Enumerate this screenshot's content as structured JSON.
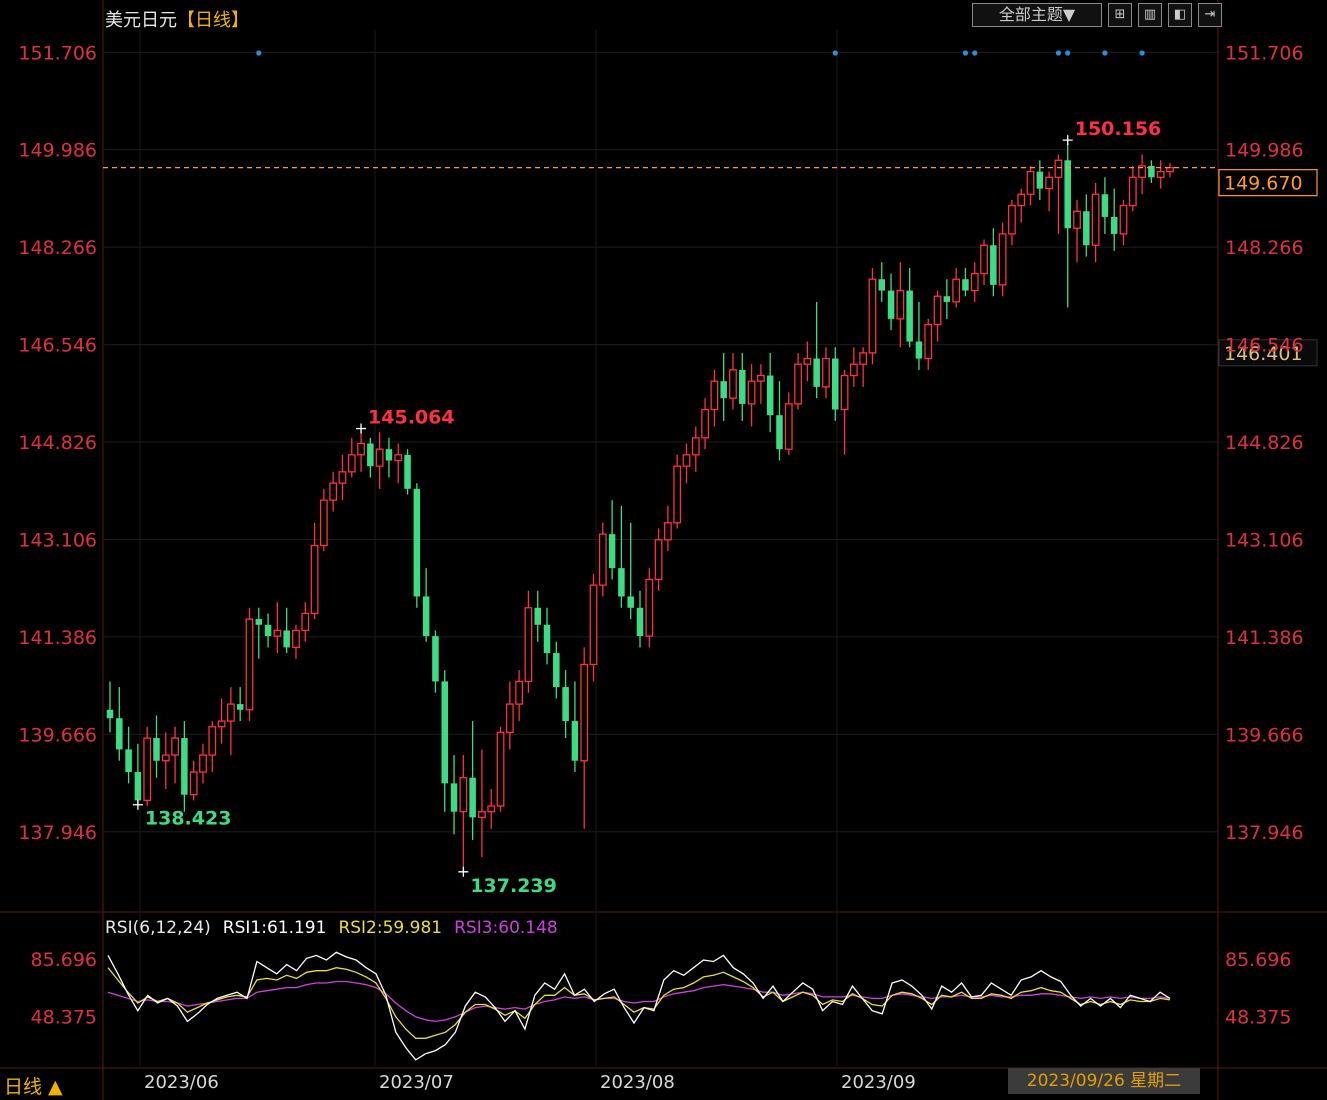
{
  "header": {
    "symbol": "美元日元",
    "period_label": "【日线】",
    "theme_button": "全部主题▼",
    "tool_icons": [
      "grid-icon",
      "panel-icon",
      "step-icon",
      "end-icon"
    ]
  },
  "colors": {
    "up": "#ff3040",
    "down": "#3ddc84",
    "price_label": "#e03040",
    "last_price_line": "#ff9a2e",
    "marker": "#2a8fd8",
    "rsi1": "#ffffff",
    "rsi2": "#e8e030",
    "rsi3": "#d040e0"
  },
  "chart_data": [
    {
      "type": "candlestick",
      "title": "美元日元【日线】",
      "y_ticks": [
        151.706,
        149.986,
        148.266,
        146.546,
        144.826,
        143.106,
        141.386,
        139.666,
        137.946
      ],
      "ylim": [
        136.6,
        152.1
      ],
      "x_ticks": [
        "2023/06",
        "2023/07",
        "2023/08",
        "2023/09"
      ],
      "last_price": 149.67,
      "right_axis_marker": 146.401,
      "annotations": [
        {
          "text": "150.156",
          "kind": "high"
        },
        {
          "text": "145.064",
          "kind": "high"
        },
        {
          "text": "138.423",
          "kind": "low"
        },
        {
          "text": "137.239",
          "kind": "low"
        }
      ],
      "ohlc": [
        [
          140.1,
          140.6,
          139.7,
          139.95
        ],
        [
          139.95,
          140.5,
          139.2,
          139.4
        ],
        [
          139.4,
          139.8,
          138.8,
          139.0
        ],
        [
          139.0,
          139.5,
          138.423,
          138.5
        ],
        [
          138.5,
          139.8,
          138.4,
          139.6
        ],
        [
          139.6,
          140.0,
          138.9,
          139.2
        ],
        [
          139.2,
          139.7,
          138.7,
          139.3
        ],
        [
          139.3,
          139.8,
          138.8,
          139.6
        ],
        [
          139.6,
          139.9,
          138.3,
          138.6
        ],
        [
          138.6,
          139.2,
          138.5,
          139.0
        ],
        [
          139.0,
          139.5,
          138.8,
          139.3
        ],
        [
          139.3,
          139.9,
          139.0,
          139.8
        ],
        [
          139.8,
          140.3,
          139.5,
          139.9
        ],
        [
          139.9,
          140.5,
          139.3,
          140.2
        ],
        [
          140.2,
          140.5,
          139.9,
          140.1
        ],
        [
          140.1,
          141.9,
          139.9,
          141.7
        ],
        [
          141.7,
          141.9,
          141.0,
          141.6
        ],
        [
          141.6,
          141.8,
          141.2,
          141.4
        ],
        [
          141.4,
          142.0,
          141.1,
          141.5
        ],
        [
          141.5,
          141.9,
          141.1,
          141.2
        ],
        [
          141.2,
          141.6,
          141.0,
          141.5
        ],
        [
          141.5,
          142.0,
          141.3,
          141.8
        ],
        [
          141.8,
          143.4,
          141.7,
          143.0
        ],
        [
          143.0,
          144.0,
          142.9,
          143.8
        ],
        [
          143.8,
          144.3,
          143.6,
          144.1
        ],
        [
          144.1,
          144.6,
          143.8,
          144.3
        ],
        [
          144.3,
          144.9,
          144.2,
          144.6
        ],
        [
          144.6,
          145.064,
          144.3,
          144.8
        ],
        [
          144.8,
          144.9,
          144.2,
          144.4
        ],
        [
          144.4,
          145.0,
          144.0,
          144.7
        ],
        [
          144.7,
          144.9,
          144.2,
          144.5
        ],
        [
          144.5,
          144.8,
          144.1,
          144.6
        ],
        [
          144.6,
          144.7,
          143.9,
          144.0
        ],
        [
          144.0,
          144.1,
          141.9,
          142.1
        ],
        [
          142.1,
          142.6,
          141.3,
          141.4
        ],
        [
          141.4,
          141.5,
          140.4,
          140.6
        ],
        [
          140.6,
          140.8,
          138.3,
          138.8
        ],
        [
          138.8,
          139.3,
          137.9,
          138.3
        ],
        [
          138.3,
          139.3,
          137.239,
          138.9
        ],
        [
          138.9,
          139.9,
          137.8,
          138.2
        ],
        [
          138.2,
          139.4,
          137.5,
          138.3
        ],
        [
          138.3,
          138.7,
          138.0,
          138.4
        ],
        [
          138.4,
          139.8,
          138.3,
          139.7
        ],
        [
          139.7,
          140.6,
          139.4,
          140.2
        ],
        [
          140.2,
          140.8,
          139.9,
          140.6
        ],
        [
          140.6,
          142.2,
          140.4,
          141.9
        ],
        [
          141.9,
          142.2,
          141.3,
          141.6
        ],
        [
          141.6,
          141.9,
          140.9,
          141.1
        ],
        [
          141.1,
          141.3,
          140.3,
          140.5
        ],
        [
          140.5,
          140.8,
          139.6,
          139.9
        ],
        [
          139.9,
          140.6,
          139.0,
          139.2
        ],
        [
          139.2,
          141.2,
          138.0,
          140.9
        ],
        [
          140.9,
          142.5,
          140.6,
          142.3
        ],
        [
          142.3,
          143.4,
          142.1,
          143.2
        ],
        [
          143.2,
          143.8,
          142.4,
          142.6
        ],
        [
          142.6,
          143.7,
          141.9,
          142.1
        ],
        [
          142.1,
          143.4,
          141.7,
          141.9
        ],
        [
          141.9,
          142.2,
          141.2,
          141.4
        ],
        [
          141.4,
          142.6,
          141.2,
          142.4
        ],
        [
          142.4,
          143.3,
          142.2,
          143.1
        ],
        [
          143.1,
          143.7,
          142.9,
          143.4
        ],
        [
          143.4,
          144.6,
          143.3,
          144.4
        ],
        [
          144.4,
          144.8,
          144.1,
          144.6
        ],
        [
          144.6,
          145.1,
          144.3,
          144.9
        ],
        [
          144.9,
          145.6,
          144.7,
          145.4
        ],
        [
          145.4,
          146.1,
          145.1,
          145.9
        ],
        [
          145.9,
          146.4,
          145.2,
          145.6
        ],
        [
          145.6,
          146.4,
          145.4,
          146.1
        ],
        [
          146.1,
          146.4,
          145.2,
          145.5
        ],
        [
          145.5,
          146.2,
          145.1,
          145.9
        ],
        [
          145.9,
          146.2,
          145.5,
          146.0
        ],
        [
          146.0,
          146.4,
          145.0,
          145.3
        ],
        [
          145.3,
          145.9,
          144.5,
          144.7
        ],
        [
          144.7,
          145.7,
          144.6,
          145.5
        ],
        [
          145.5,
          146.4,
          145.4,
          146.2
        ],
        [
          146.2,
          146.6,
          145.9,
          146.3
        ],
        [
          146.3,
          147.3,
          145.6,
          145.8
        ],
        [
          145.8,
          146.5,
          145.6,
          146.3
        ],
        [
          146.3,
          146.5,
          145.2,
          145.4
        ],
        [
          145.4,
          146.1,
          144.6,
          146.0
        ],
        [
          146.0,
          146.5,
          145.8,
          146.2
        ],
        [
          146.2,
          146.5,
          145.8,
          146.4
        ],
        [
          146.4,
          147.9,
          146.2,
          147.7
        ],
        [
          147.7,
          148.0,
          147.3,
          147.5
        ],
        [
          147.5,
          147.8,
          146.8,
          147.0
        ],
        [
          147.0,
          148.0,
          146.5,
          147.5
        ],
        [
          147.5,
          147.9,
          146.5,
          146.6
        ],
        [
          146.6,
          147.3,
          146.1,
          146.3
        ],
        [
          146.3,
          147.0,
          146.1,
          146.9
        ],
        [
          146.9,
          147.5,
          146.6,
          147.4
        ],
        [
          147.4,
          147.7,
          147.0,
          147.3
        ],
        [
          147.3,
          147.9,
          147.2,
          147.7
        ],
        [
          147.7,
          147.9,
          147.4,
          147.5
        ],
        [
          147.5,
          148.0,
          147.3,
          147.8
        ],
        [
          147.8,
          148.4,
          147.6,
          148.3
        ],
        [
          148.3,
          148.6,
          147.4,
          147.6
        ],
        [
          147.6,
          148.7,
          147.4,
          148.5
        ],
        [
          148.5,
          149.1,
          148.3,
          149.0
        ],
        [
          149.0,
          149.3,
          148.7,
          149.2
        ],
        [
          149.2,
          149.7,
          149.0,
          149.6
        ],
        [
          149.6,
          149.8,
          149.1,
          149.3
        ],
        [
          149.3,
          149.6,
          148.9,
          149.5
        ],
        [
          149.5,
          149.9,
          148.5,
          149.8
        ],
        [
          149.8,
          150.156,
          147.2,
          148.6
        ],
        [
          148.6,
          149.1,
          148.0,
          148.9
        ],
        [
          148.9,
          149.2,
          148.1,
          148.3
        ],
        [
          148.3,
          149.4,
          148.0,
          149.2
        ],
        [
          149.2,
          149.5,
          148.5,
          148.8
        ],
        [
          148.8,
          149.3,
          148.2,
          148.5
        ],
        [
          148.5,
          149.1,
          148.3,
          149.0
        ],
        [
          149.0,
          149.7,
          148.9,
          149.5
        ],
        [
          149.5,
          149.9,
          149.2,
          149.7
        ],
        [
          149.7,
          149.8,
          149.4,
          149.5
        ],
        [
          149.5,
          149.8,
          149.3,
          149.6
        ],
        [
          149.6,
          149.75,
          149.5,
          149.67
        ]
      ],
      "signal_markers": [
        16,
        78,
        92,
        93,
        102,
        103,
        107,
        111
      ]
    },
    {
      "type": "line",
      "title": "RSI(6,12,24)",
      "y_ticks": [
        85.696,
        48.375
      ],
      "ylim": [
        16,
        98
      ],
      "series": [
        {
          "name": "RSI1",
          "last": 61.191,
          "values": [
            88,
            76,
            63,
            52,
            62,
            57,
            60,
            55,
            45,
            50,
            56,
            60,
            62,
            64,
            60,
            84,
            80,
            76,
            82,
            78,
            86,
            88,
            85,
            90,
            87,
            85,
            80,
            76,
            62,
            38,
            28,
            20,
            24,
            26,
            30,
            38,
            55,
            64,
            61,
            54,
            45,
            52,
            40,
            62,
            70,
            66,
            76,
            62,
            66,
            58,
            63,
            66,
            54,
            44,
            54,
            52,
            72,
            78,
            75,
            80,
            85,
            84,
            88,
            80,
            76,
            70,
            60,
            68,
            58,
            64,
            70,
            66,
            52,
            58,
            56,
            68,
            60,
            52,
            50,
            70,
            72,
            68,
            62,
            53,
            68,
            64,
            70,
            61,
            62,
            70,
            66,
            62,
            72,
            74,
            78,
            74,
            71,
            62,
            55,
            60,
            55,
            60,
            54,
            62,
            60,
            58,
            64,
            60
          ]
        },
        {
          "name": "RSI2",
          "last": 59.981,
          "values": [
            80,
            72,
            64,
            57,
            61,
            58,
            60,
            57,
            51,
            54,
            57,
            59,
            61,
            62,
            61,
            72,
            73,
            72,
            75,
            73,
            77,
            78,
            78,
            80,
            79,
            77,
            74,
            70,
            60,
            48,
            40,
            34,
            34,
            36,
            38,
            43,
            51,
            56,
            56,
            53,
            49,
            52,
            47,
            56,
            62,
            62,
            67,
            62,
            63,
            59,
            60,
            61,
            56,
            51,
            54,
            53,
            62,
            66,
            67,
            70,
            74,
            75,
            77,
            74,
            71,
            67,
            61,
            64,
            58,
            61,
            64,
            62,
            56,
            59,
            58,
            63,
            60,
            56,
            55,
            62,
            64,
            63,
            60,
            56,
            62,
            61,
            64,
            60,
            60,
            63,
            62,
            60,
            64,
            65,
            67,
            65,
            64,
            60,
            56,
            58,
            56,
            58,
            56,
            59,
            58,
            58,
            60,
            59
          ]
        },
        {
          "name": "RSI3",
          "last": 60.148,
          "values": [
            64,
            62,
            60,
            58,
            59,
            58,
            58,
            57,
            55,
            56,
            57,
            58,
            59,
            60,
            60,
            64,
            65,
            66,
            67,
            67,
            69,
            70,
            70,
            71,
            71,
            70,
            69,
            67,
            63,
            57,
            52,
            48,
            46,
            45,
            46,
            48,
            51,
            54,
            55,
            54,
            53,
            54,
            53,
            56,
            58,
            59,
            61,
            60,
            61,
            59,
            60,
            60,
            58,
            57,
            58,
            58,
            61,
            63,
            64,
            65,
            67,
            68,
            69,
            68,
            67,
            66,
            64,
            64,
            62,
            63,
            64,
            63,
            61,
            61,
            61,
            62,
            61,
            60,
            60,
            62,
            63,
            62,
            61,
            60,
            61,
            61,
            62,
            61,
            61,
            62,
            61,
            61,
            62,
            62,
            63,
            63,
            62,
            61,
            60,
            61,
            60,
            61,
            60,
            61,
            60,
            60,
            61,
            60
          ]
        }
      ]
    }
  ],
  "rsi_header": {
    "name": "RSI(6,12,24)",
    "rsi1": "RSI1:61.191",
    "rsi2": "RSI2:59.981",
    "rsi3": "RSI3:60.148"
  },
  "footer": {
    "period_switch": "日线 ▲",
    "cursor_date": "2023/09/26 星期二"
  }
}
